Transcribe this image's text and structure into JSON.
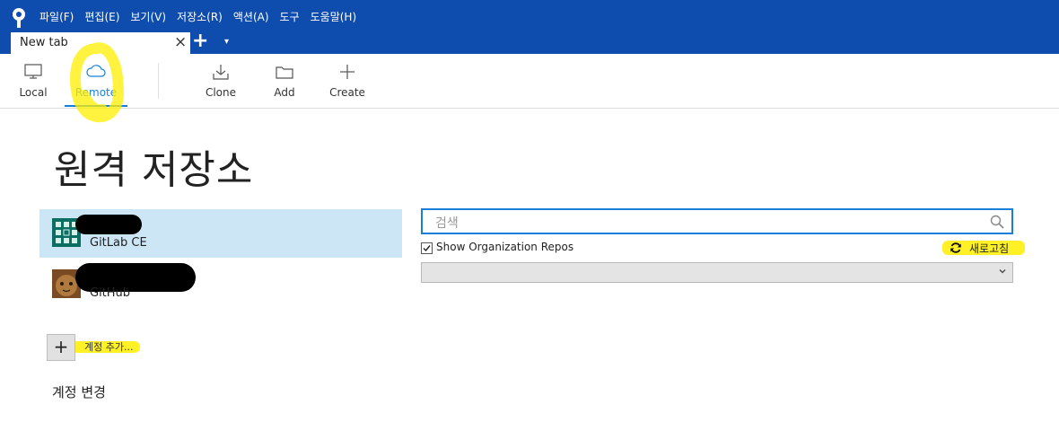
{
  "menu": [
    "파일(F)",
    "편집(E)",
    "보기(V)",
    "저장소(R)",
    "액션(A)",
    "도구",
    "도움말(H)"
  ],
  "tab": {
    "label": "New tab",
    "close": "×",
    "add": "+",
    "menu": "▾"
  },
  "toolbar": {
    "local": "Local",
    "remote": "Remote",
    "clone": "Clone",
    "add": "Add",
    "create": "Create"
  },
  "page": {
    "title": "원격 저장소"
  },
  "accounts": [
    {
      "label": "GitLab CE",
      "selected": true
    },
    {
      "label": "GitHub",
      "selected": false
    }
  ],
  "add_account": {
    "icon": "+",
    "label": "계정 추가..."
  },
  "change_account": {
    "label": "계정 변경"
  },
  "search": {
    "placeholder": "검색"
  },
  "org_repos": {
    "label": "Show Organization Repos",
    "checked": true
  },
  "refresh": {
    "label": "새로고침"
  },
  "colors": {
    "titlebar": "#0e4dae",
    "accent": "#1a7fd6",
    "selected_row": "#cde6f6",
    "highlight": "#ffef00"
  }
}
